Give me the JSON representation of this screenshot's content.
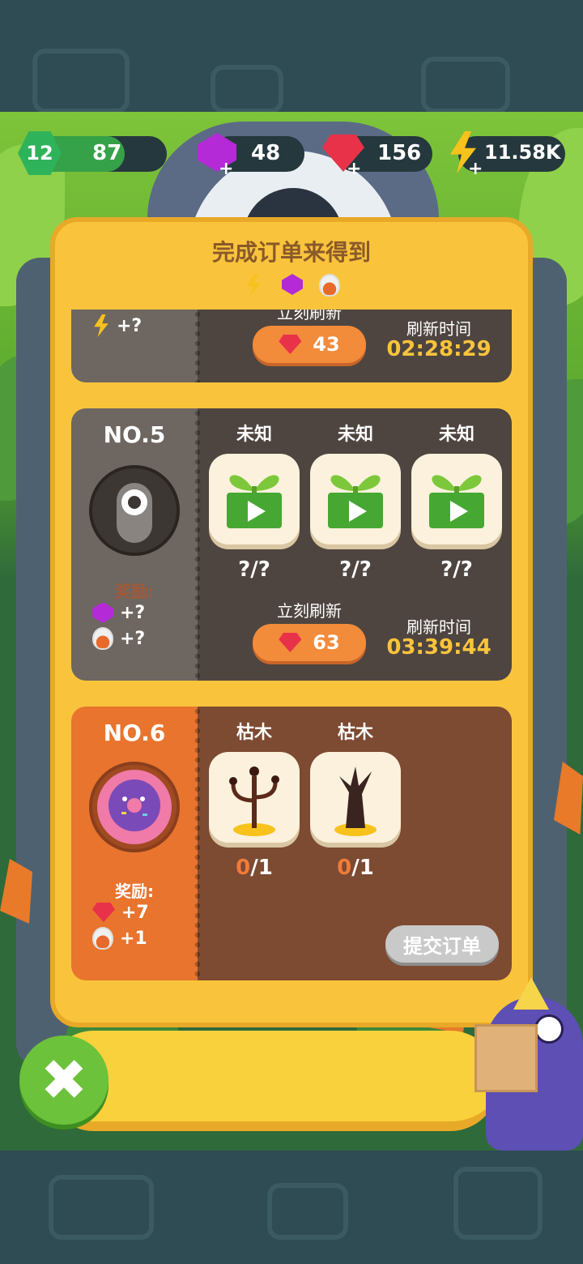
{
  "resources": {
    "level": "12",
    "xp": "87",
    "purple_gems": "48",
    "red_gems": "156",
    "energy": "11.58K"
  },
  "panel": {
    "title": "完成订单来得到",
    "reward_icons": [
      "bolt-icon",
      "purple-gem-icon",
      "potion-icon"
    ]
  },
  "order_top": {
    "reward_text": "+?",
    "refresh_label": "立刻刷新",
    "refresh_cost": "43",
    "timer_label": "刷新时间",
    "timer": "02:28:29"
  },
  "order5": {
    "number": "NO.5",
    "reward_label": "奖励:",
    "rewards": [
      "+?",
      "+?"
    ],
    "items": [
      {
        "name": "未知",
        "progress": "?/?"
      },
      {
        "name": "未知",
        "progress": "?/?"
      },
      {
        "name": "未知",
        "progress": "?/?"
      }
    ],
    "refresh_label": "立刻刷新",
    "refresh_cost": "63",
    "timer_label": "刷新时间",
    "timer": "03:39:44"
  },
  "order6": {
    "number": "NO.6",
    "reward_label": "奖励:",
    "rewards": [
      "+7",
      "+1"
    ],
    "items": [
      {
        "name": "枯木",
        "have": "0",
        "need": "/1"
      },
      {
        "name": "枯木",
        "have": "0",
        "need": "/1"
      }
    ],
    "submit_label": "提交订单"
  },
  "close_label": "✖",
  "colors": {
    "panel": "#f9c43c",
    "card_dark": "#4e4540",
    "card_dark_left": "#6e6661",
    "card_active": "#7d4a32",
    "card_active_left": "#e8742e",
    "timer": "#f9c43c",
    "refresh_button": "#f28b3a"
  }
}
